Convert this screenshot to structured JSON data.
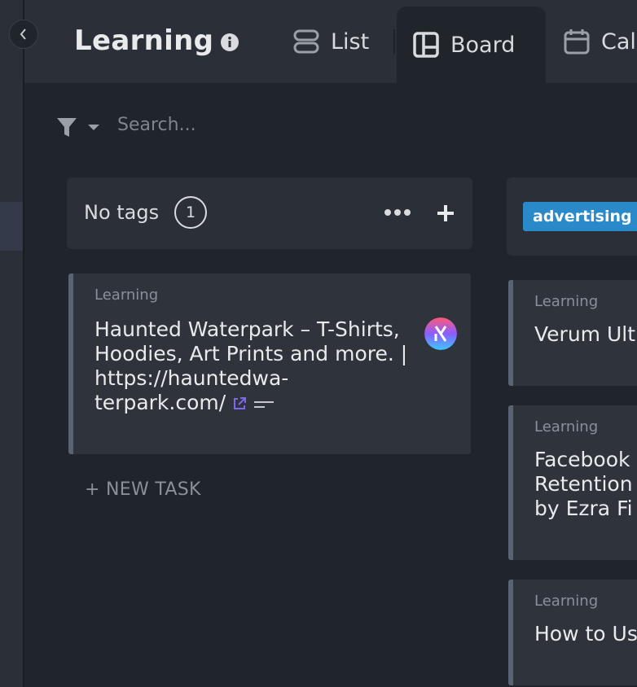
{
  "header": {
    "title": "Learning",
    "tabs": [
      {
        "label": "List",
        "icon": "list-icon"
      },
      {
        "label": "Board",
        "icon": "board-icon"
      },
      {
        "label": "Cal",
        "icon": "calendar-icon"
      }
    ]
  },
  "toolbar": {
    "search_placeholder": "Search..."
  },
  "columns": [
    {
      "title": "No tags",
      "count": "1",
      "cards": [
        {
          "list": "Learning",
          "title": "Haunted Waterpark – T-Shirts, Hoodies, Art Prints and more. | https://hauntedwa-terpark.com/"
        }
      ],
      "new_task_label": "+ NEW TASK"
    },
    {
      "title": "advertising",
      "cards": [
        {
          "list": "Learning",
          "title": "Verum Ult"
        },
        {
          "list": "Learning",
          "title": "Facebook\nRetention\nby Ezra Fi"
        },
        {
          "list": "Learning",
          "title": "How to Us"
        }
      ]
    }
  ],
  "colors": {
    "background": "#20242b",
    "header": "#2b3038",
    "card": "#2f343c",
    "tag": "#2a8ac9",
    "link_icon": "#7b68ee"
  }
}
